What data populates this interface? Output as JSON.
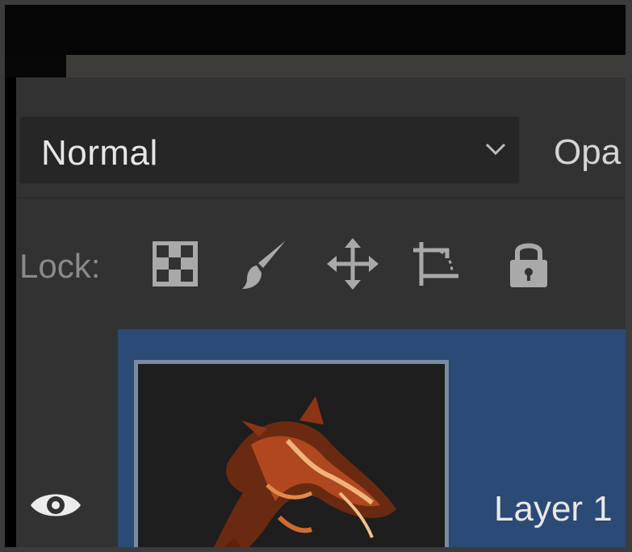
{
  "layers_panel": {
    "blend_mode": {
      "value": "Normal"
    },
    "opacity": {
      "label": "Opa"
    },
    "lock": {
      "label": "Lock:",
      "buttons": [
        {
          "name": "lock-transparent-pixels",
          "icon": "checkerboard-icon"
        },
        {
          "name": "lock-image-pixels",
          "icon": "paintbrush-icon"
        },
        {
          "name": "lock-position",
          "icon": "move-arrows-icon"
        },
        {
          "name": "lock-artboard",
          "icon": "artboard-crop-icon"
        },
        {
          "name": "lock-all",
          "icon": "padlock-icon"
        }
      ]
    },
    "layer": {
      "name": "Layer 1",
      "visible": true,
      "selected": true,
      "selection_color": "#2b4a75"
    }
  }
}
